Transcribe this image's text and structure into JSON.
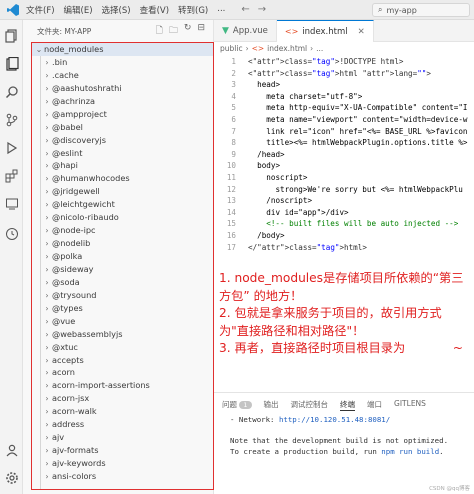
{
  "titlebar": {
    "menu": [
      "文件(F)",
      "编辑(E)",
      "选择(S)",
      "查看(V)",
      "转到(G)",
      "..."
    ],
    "search": "my-app"
  },
  "explorer": {
    "title": "文件夹: MY-APP",
    "root": "node_modules",
    "items": [
      ".bin",
      ".cache",
      "@aashutoshrathi",
      "@achrinza",
      "@ampproject",
      "@babel",
      "@discoveryjs",
      "@eslint",
      "@hapi",
      "@humanwhocodes",
      "@jridgewell",
      "@leichtgewicht",
      "@nicolo-ribaudo",
      "@node-ipc",
      "@nodelib",
      "@polka",
      "@sideway",
      "@soda",
      "@trysound",
      "@types",
      "@vue",
      "@webassemblyjs",
      "@xtuc",
      "accepts",
      "acorn",
      "acorn-import-assertions",
      "acorn-jsx",
      "acorn-walk",
      "address",
      "ajv",
      "ajv-formats",
      "ajv-keywords",
      "ansi-colors"
    ]
  },
  "tabs": [
    {
      "label": "App.vue",
      "active": false
    },
    {
      "label": "index.html",
      "active": true
    }
  ],
  "breadcrumb": [
    "public",
    "index.html",
    "..."
  ],
  "code": {
    "line_numbers": [
      "1",
      "2",
      "3",
      "4",
      "5",
      "6",
      "7",
      "8",
      "9",
      "10",
      "11",
      "12",
      "13",
      "14",
      "15",
      "16",
      "17"
    ],
    "lines": [
      "<!DOCTYPE html>",
      "<html lang=\"\">",
      "  <head>",
      "    <meta charset=\"utf-8\">",
      "    <meta http-equiv=\"X-UA-Compatible\" content=\"I",
      "    <meta name=\"viewport\" content=\"width=device-w",
      "    <link rel=\"icon\" href=\"<%= BASE_URL %>favicon",
      "    <title><%= htmlWebpackPlugin.options.title %>",
      "  </head>",
      "  <body>",
      "    <noscript>",
      "      <strong>We're sorry but <%= htmlWebpackPlu",
      "    </noscript>",
      "    <div id=\"app\"></div>",
      "    <!-- built files will be auto injected -->",
      "  </body>",
      "</html>"
    ]
  },
  "annotation": [
    "1. node_modules是存储项目所依赖的“第三方包” 的地方！",
    "2. 包就是拿来服务于项目的，故引用方式为\"直接路径和相对路径\"！",
    "3. 再者，直接路径时项目根目录为",
    "~"
  ],
  "panel": {
    "tabs": [
      "问题",
      "1",
      "输出",
      "调试控制台",
      "终端",
      "端口",
      "GITLENS"
    ],
    "network_prefix": "- Network: ",
    "network_url": "http://10.120.51.48:8081/",
    "note1": "Note that the development build is not optimized.",
    "note2_a": "To create a production build, run ",
    "note2_b": "npm run build",
    "note2_c": "."
  },
  "watermark": "CSDN @qq博客"
}
